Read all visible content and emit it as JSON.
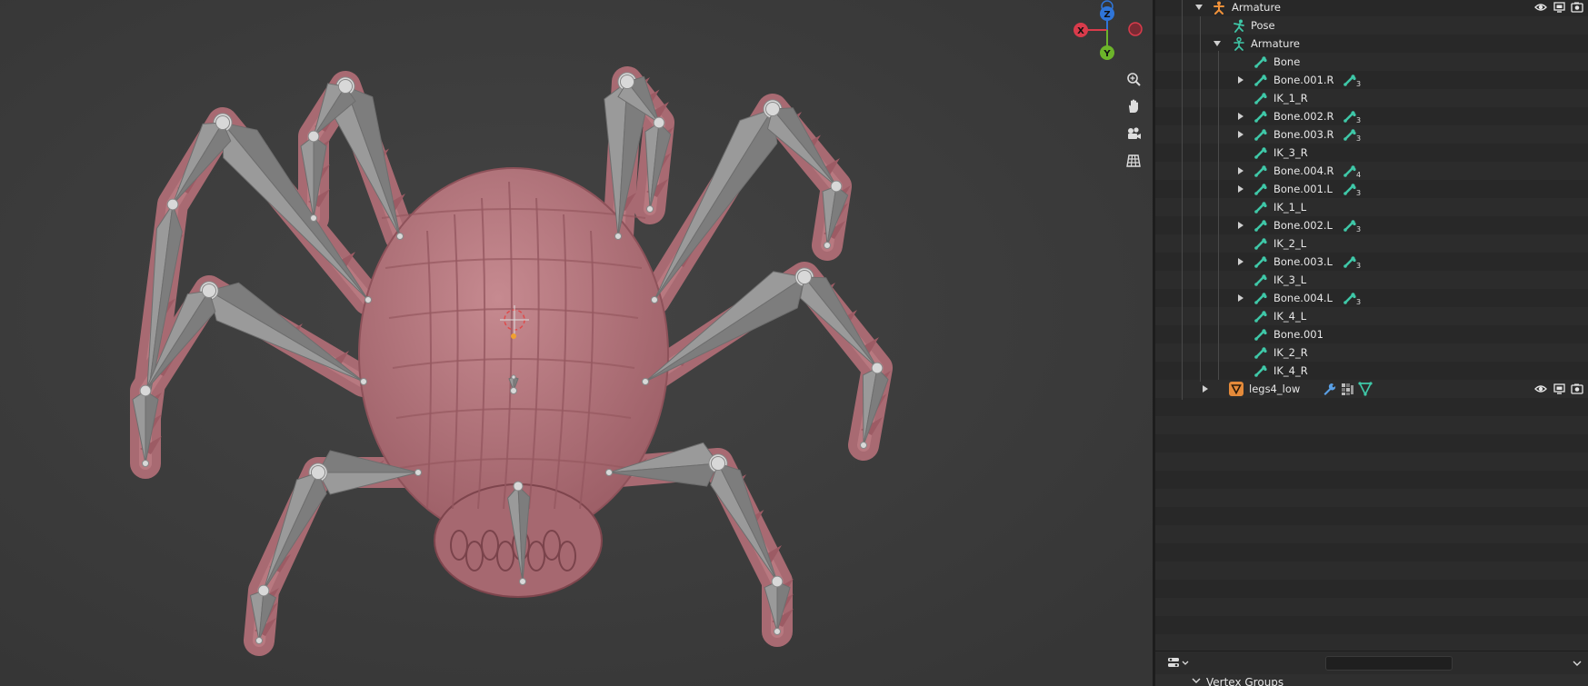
{
  "viewport": {
    "gizmo": {
      "z_label": "Z",
      "x_label": "X",
      "y_label": "Y"
    },
    "nav_tools": [
      "zoom-icon",
      "hand-pan-icon",
      "camera-icon",
      "grid-icon"
    ],
    "colors": {
      "background": "#3d3d3d",
      "mesh": "#b07078",
      "bones": "#8a8a8a",
      "x_axis": "#d93b4b",
      "y_axis": "#6cb42a",
      "z_axis": "#2f75d8"
    }
  },
  "outliner": {
    "items": [
      {
        "label": "Armature",
        "icon": "armature-object-icon",
        "expanded": true,
        "depth": 0,
        "visibility": true
      },
      {
        "label": "Pose",
        "icon": "pose-icon",
        "depth": 1
      },
      {
        "label": "Armature",
        "icon": "armature-data-icon",
        "expanded": true,
        "depth": 1
      },
      {
        "label": "Bone",
        "icon": "bone-icon",
        "depth": 2
      },
      {
        "label": "Bone.001.R",
        "icon": "bone-icon",
        "collapsed": true,
        "depth": 2,
        "children": "3"
      },
      {
        "label": "IK_1_R",
        "icon": "bone-icon",
        "depth": 2
      },
      {
        "label": "Bone.002.R",
        "icon": "bone-icon",
        "collapsed": true,
        "depth": 2,
        "children": "3"
      },
      {
        "label": "Bone.003.R",
        "icon": "bone-icon",
        "collapsed": true,
        "depth": 2,
        "children": "3"
      },
      {
        "label": "IK_3_R",
        "icon": "bone-icon",
        "depth": 2
      },
      {
        "label": "Bone.004.R",
        "icon": "bone-icon",
        "collapsed": true,
        "depth": 2,
        "children": "4"
      },
      {
        "label": "Bone.001.L",
        "icon": "bone-icon",
        "collapsed": true,
        "depth": 2,
        "children": "3"
      },
      {
        "label": "IK_1_L",
        "icon": "bone-icon",
        "depth": 2
      },
      {
        "label": "Bone.002.L",
        "icon": "bone-icon",
        "collapsed": true,
        "depth": 2,
        "children": "3"
      },
      {
        "label": "IK_2_L",
        "icon": "bone-icon",
        "depth": 2
      },
      {
        "label": "Bone.003.L",
        "icon": "bone-icon",
        "collapsed": true,
        "depth": 2,
        "children": "3"
      },
      {
        "label": "IK_3_L",
        "icon": "bone-icon",
        "depth": 2
      },
      {
        "label": "Bone.004.L",
        "icon": "bone-icon",
        "collapsed": true,
        "depth": 2,
        "children": "3"
      },
      {
        "label": "IK_4_L",
        "icon": "bone-icon",
        "depth": 2
      },
      {
        "label": "Bone.001",
        "icon": "bone-icon",
        "depth": 2
      },
      {
        "label": "IK_2_R",
        "icon": "bone-icon",
        "depth": 2
      },
      {
        "label": "IK_4_R",
        "icon": "bone-icon",
        "depth": 2
      },
      {
        "label": "legs4_low",
        "icon": "mesh-object-icon",
        "collapsed": true,
        "depth": 1,
        "visibility": true,
        "extra_icons": [
          "wrench-icon",
          "vertex-groups-icon",
          "mesh-data-icon"
        ]
      }
    ]
  },
  "properties": {
    "search_placeholder": "",
    "panel_title": "Vertex Groups"
  }
}
